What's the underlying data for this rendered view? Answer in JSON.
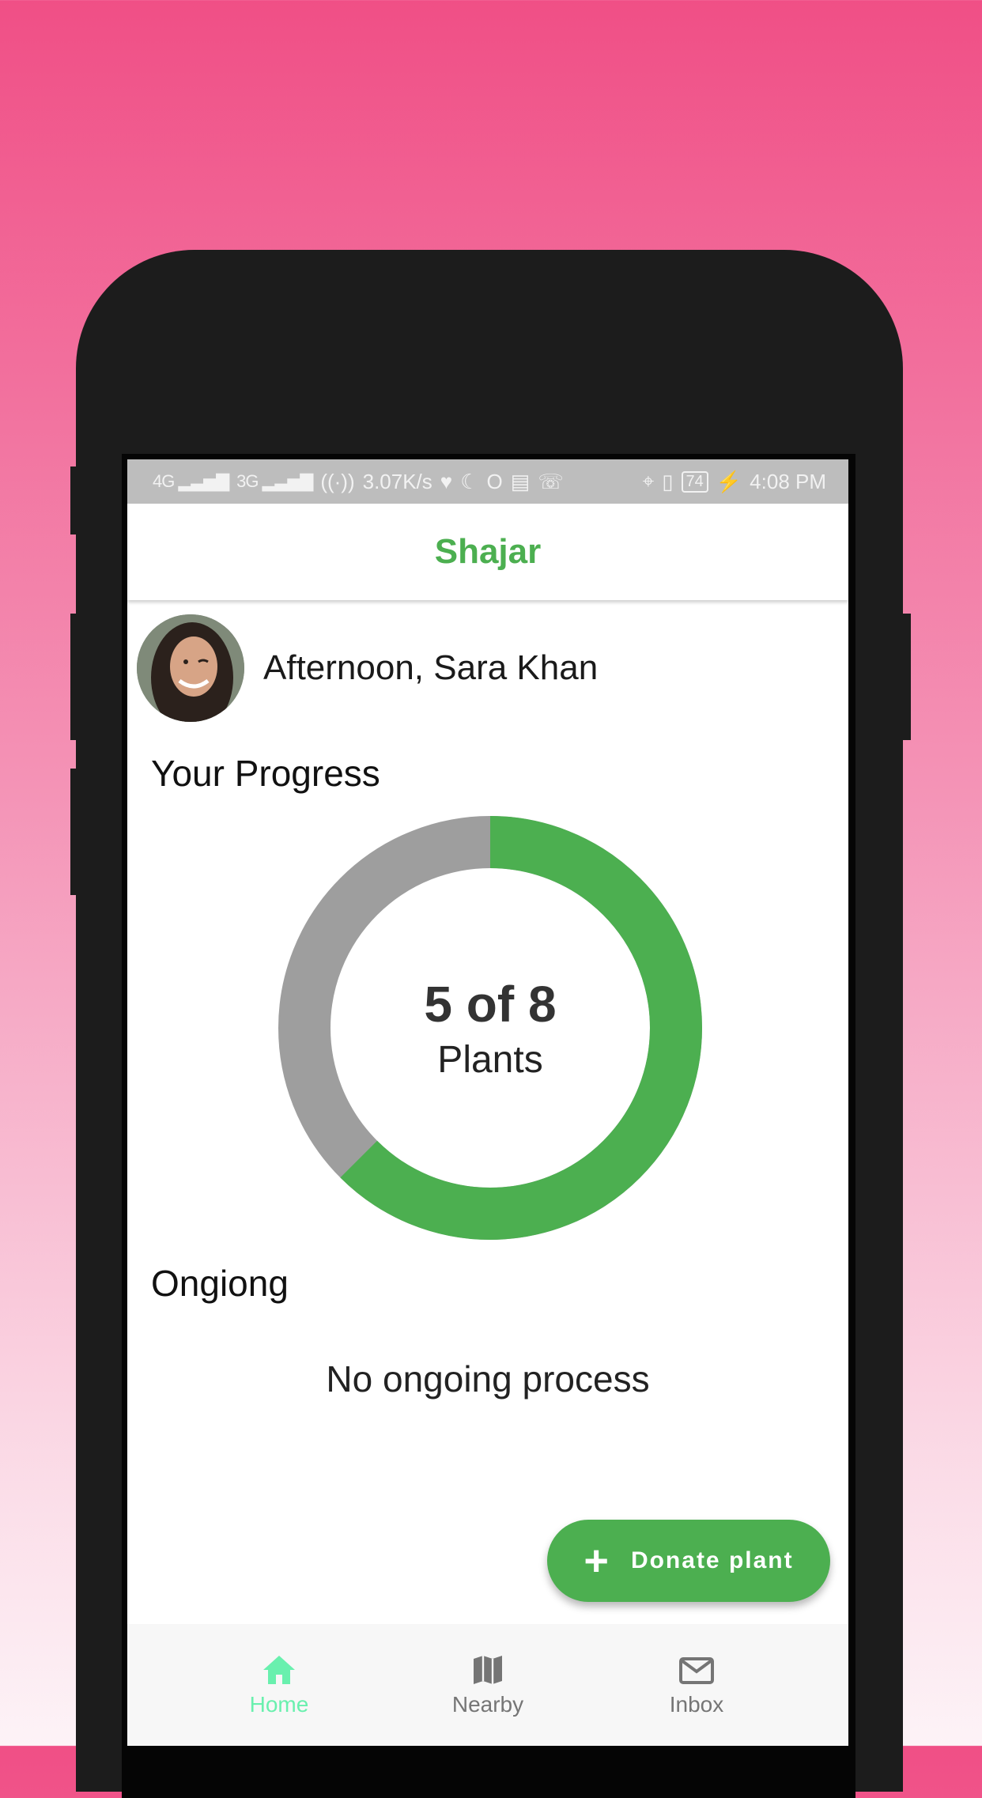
{
  "status_bar": {
    "network_left": "4G ",
    "network_right": "3G ",
    "speed": "3.07K/s",
    "battery": "74",
    "time": "4:08 PM"
  },
  "app": {
    "title": "Shajar"
  },
  "user": {
    "greeting": "Afternoon, Sara Khan"
  },
  "progress": {
    "section_title": "Your Progress",
    "count_text": "5 of 8",
    "unit": "Plants",
    "completed": 5,
    "total": 8,
    "completed_color": "#4caf50",
    "remaining_color": "#9e9e9e"
  },
  "ongoing": {
    "section_title": "Ongiong",
    "empty_message": "No ongoing process"
  },
  "fab": {
    "label": "Donate plant",
    "icon": "plus-icon"
  },
  "bottom_nav": {
    "active_color": "#69f0ae",
    "items": [
      {
        "label": "Home",
        "icon": "home-icon",
        "active": true
      },
      {
        "label": "Nearby",
        "icon": "map-icon",
        "active": false
      },
      {
        "label": "Inbox",
        "icon": "mail-icon",
        "active": false
      }
    ]
  }
}
